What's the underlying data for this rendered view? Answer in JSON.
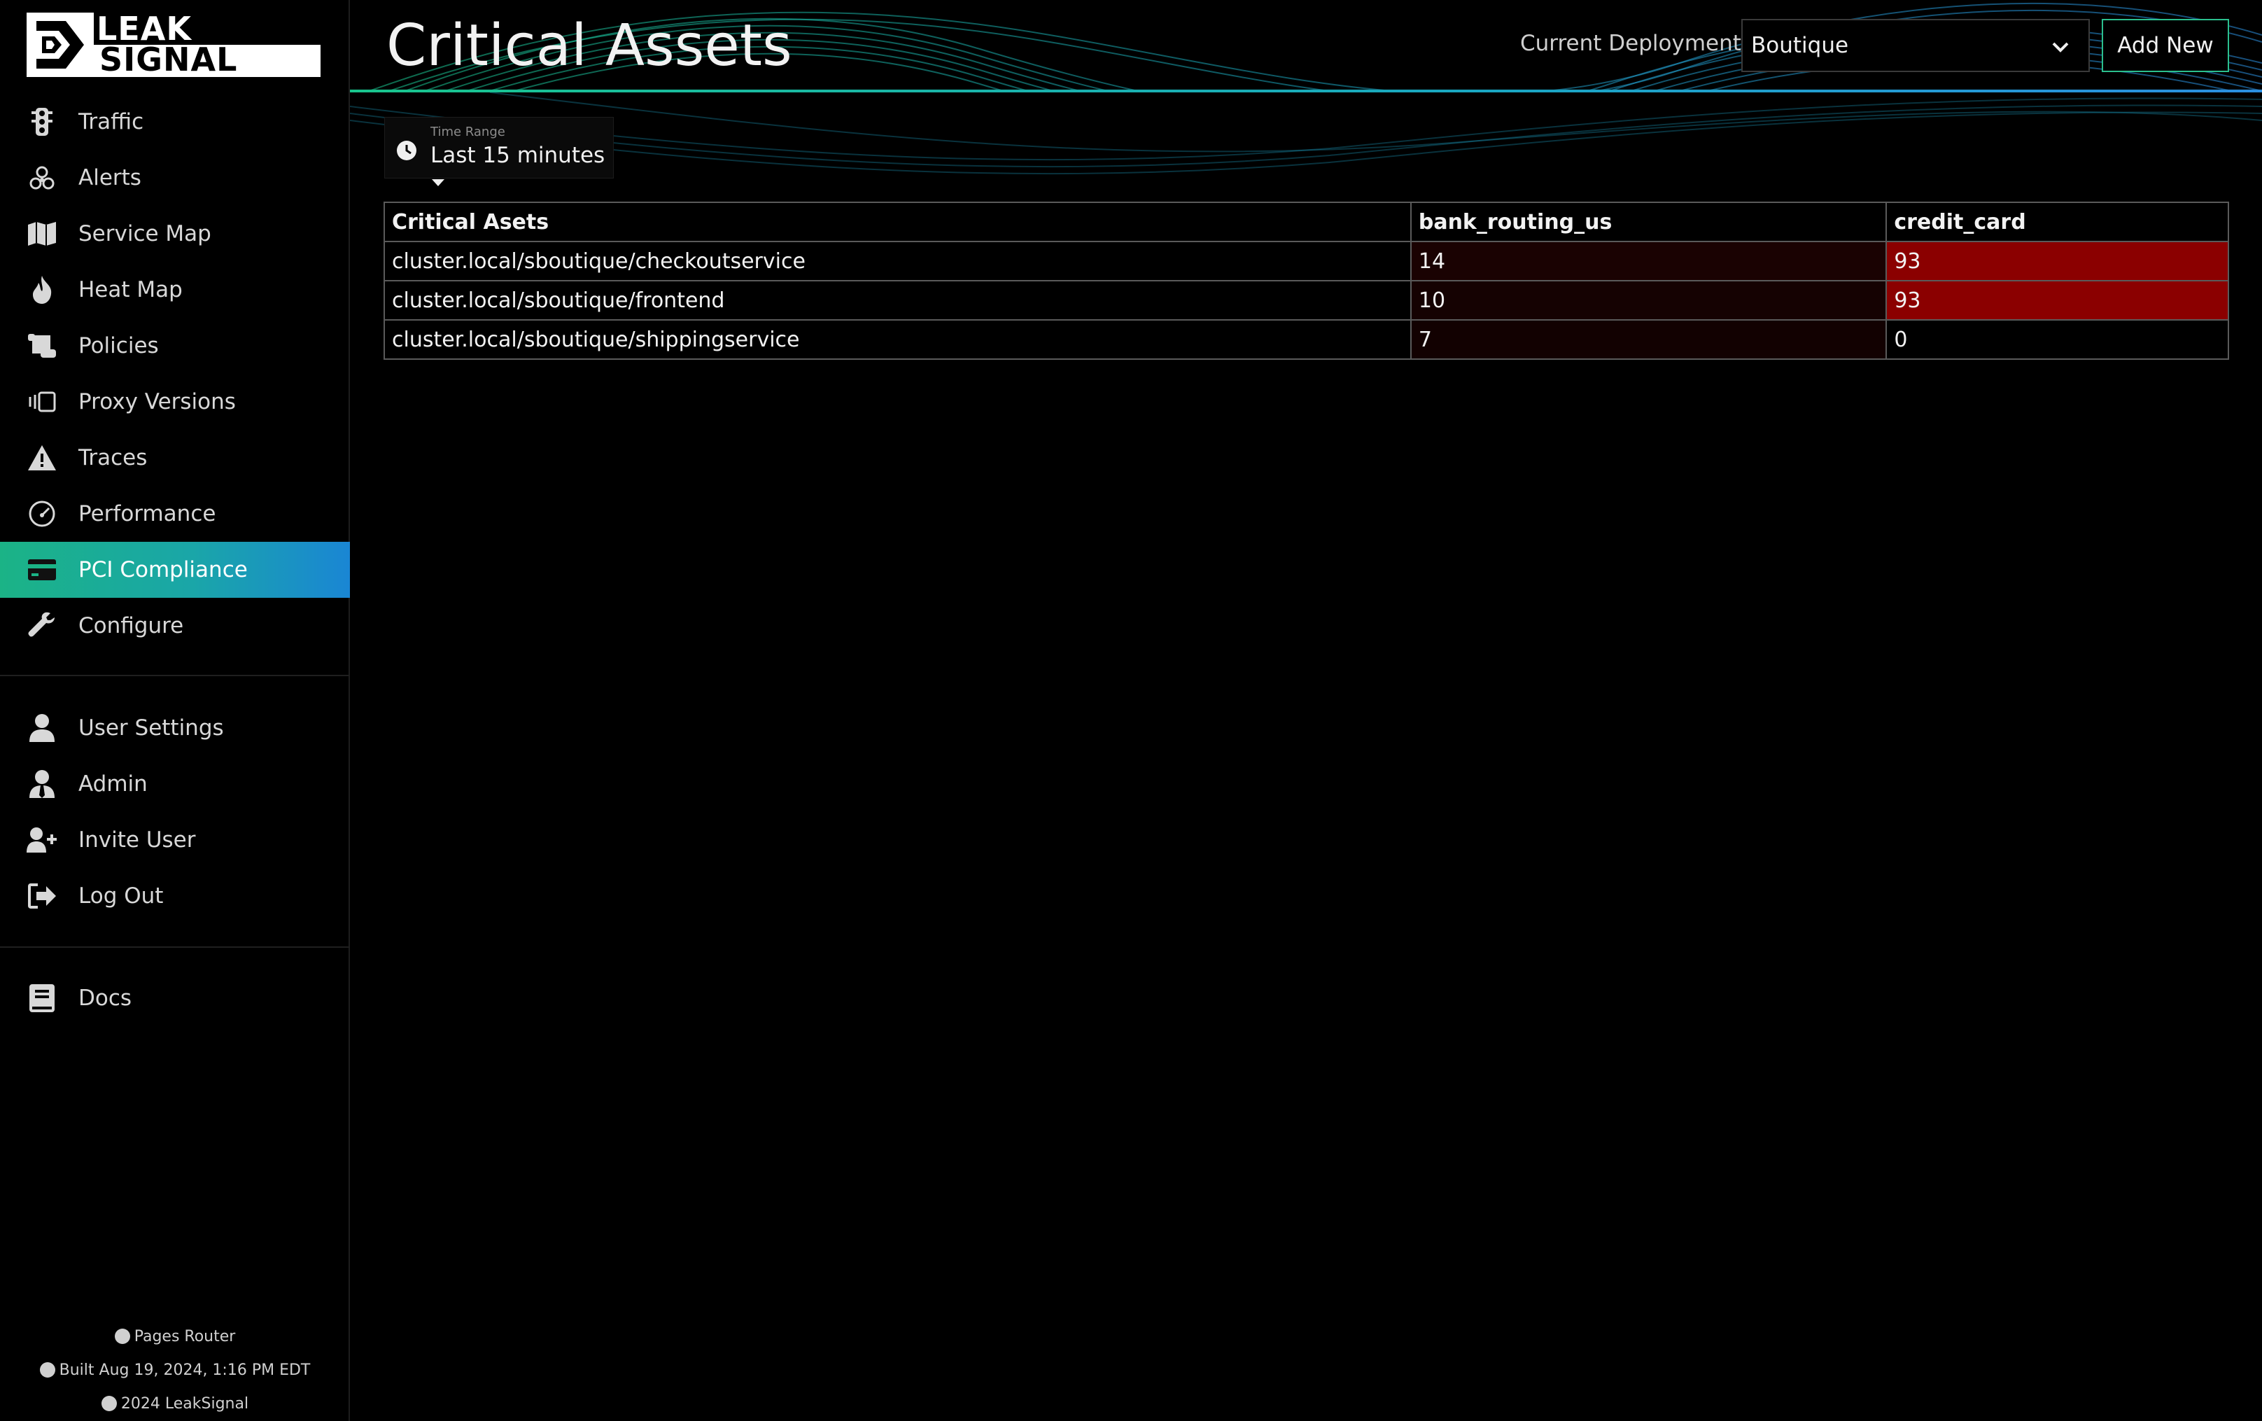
{
  "app": {
    "logo_top": "LEAK",
    "logo_bottom": "SIGNAL"
  },
  "sidebar": {
    "items": [
      {
        "label": "Traffic",
        "icon": "traffic-light-icon"
      },
      {
        "label": "Alerts",
        "icon": "biohazard-icon"
      },
      {
        "label": "Service Map",
        "icon": "map-icon"
      },
      {
        "label": "Heat Map",
        "icon": "flame-icon"
      },
      {
        "label": "Policies",
        "icon": "scroll-icon"
      },
      {
        "label": "Proxy Versions",
        "icon": "versions-icon"
      },
      {
        "label": "Traces",
        "icon": "warning-triangle-icon"
      },
      {
        "label": "Performance",
        "icon": "gauge-icon"
      },
      {
        "label": "PCI Compliance",
        "icon": "credit-card-icon",
        "active": true
      },
      {
        "label": "Configure",
        "icon": "wrench-icon"
      }
    ],
    "account_items": [
      {
        "label": "User Settings",
        "icon": "user-icon"
      },
      {
        "label": "Admin",
        "icon": "user-tie-icon"
      },
      {
        "label": "Invite User",
        "icon": "user-plus-icon"
      },
      {
        "label": "Log Out",
        "icon": "logout-icon"
      }
    ],
    "docs_items": [
      {
        "label": "Docs",
        "icon": "book-icon"
      }
    ],
    "footer": {
      "router": "Pages Router",
      "built": "Built Aug 19, 2024, 1:16 PM EDT",
      "copyright": "2024 LeakSignal"
    }
  },
  "header": {
    "title": "Critical Assets",
    "deployment_label": "Current Deployment:",
    "deployment_value": "Boutique",
    "add_new_label": "Add New"
  },
  "time_range": {
    "label": "Time Range",
    "value": "Last 15 minutes"
  },
  "table": {
    "headers": [
      "Critical Asets",
      "bank_routing_us",
      "credit_card"
    ],
    "rows": [
      [
        "cluster.local/sboutique/checkoutservice",
        "14",
        "93"
      ],
      [
        "cluster.local/sboutique/frontend",
        "10",
        "93"
      ],
      [
        "cluster.local/sboutique/shippingservice",
        "7",
        "0"
      ]
    ]
  },
  "colors": {
    "accent_green": "#1bb386",
    "accent_blue": "#1a86d4",
    "heat_high": "#8b0000",
    "heat_low": "#1a0202",
    "heat_very_low": "#120101"
  }
}
